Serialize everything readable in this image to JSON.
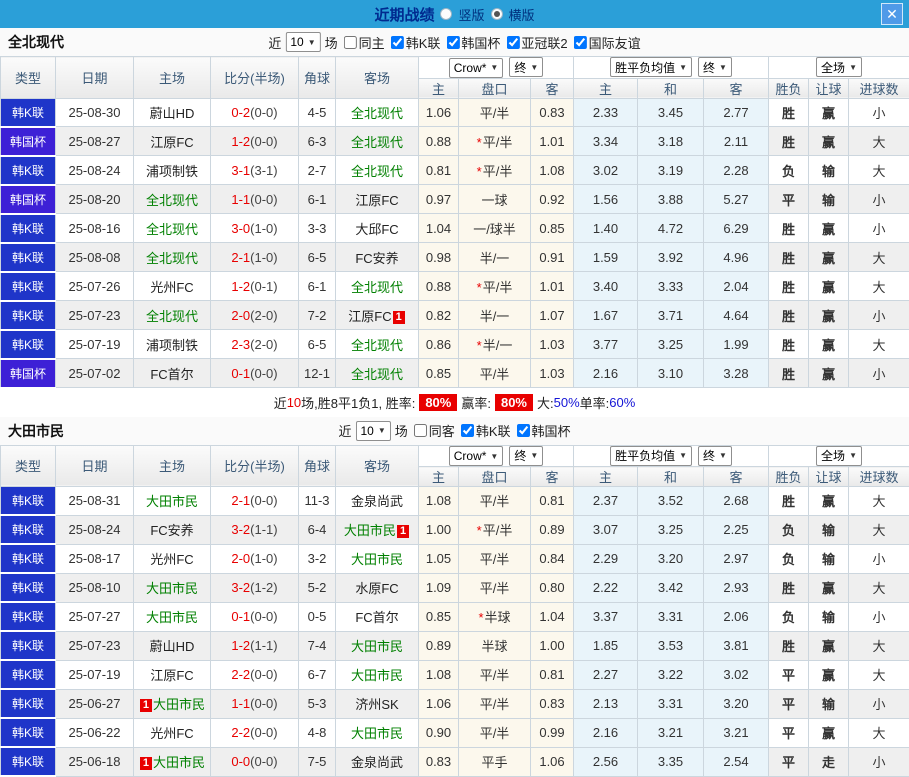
{
  "colors": {
    "titlebar_blue": "#2b9fd8",
    "kleague_badge": "#1f35c9",
    "cup_badge": "#3d20d6",
    "win_red": "#d60000",
    "lose_green": "#008000",
    "draw_blue": "#0000e0",
    "odds_bg": "#fcf8ed",
    "avg_bg": "#e9f4fa",
    "summary_badge_bg": "#e80000"
  },
  "titlebar": {
    "title": "近期战绩",
    "vertical_label": "竖版",
    "horizontal_label": "横版",
    "close": "✕"
  },
  "sections": [
    {
      "team": "全北现代",
      "filter": {
        "prefix": "近",
        "count": "10",
        "suffix": "场",
        "same_label": "同主",
        "same_checked": false,
        "leagues": [
          {
            "label": "韩K联",
            "checked": true
          },
          {
            "label": "韩国杯",
            "checked": true
          },
          {
            "label": "亚冠联2",
            "checked": true
          },
          {
            "label": "国际友谊",
            "checked": true
          }
        ]
      },
      "head": {
        "main": [
          "类型",
          "日期",
          "主场",
          "比分(半场)",
          "角球",
          "客场"
        ],
        "sub": [
          "主",
          "盘口",
          "客",
          "主",
          "和",
          "客",
          "胜负",
          "让球",
          "进球数"
        ],
        "selects": {
          "book": "Crow*",
          "end1": "终",
          "avg": "胜平负均值",
          "end2": "终",
          "scope": "全场"
        }
      },
      "rows": [
        {
          "lg": "韩K联",
          "lgc": "kl",
          "date": "25-08-30",
          "home": {
            "n": "蔚山HD"
          },
          "score": "0-2",
          "half": "(0-0)",
          "cor": "4-5",
          "away": {
            "n": "全北现代",
            "g": 1
          },
          "o1": "1.06",
          "star": "",
          "pk": "平/半",
          "o2": "0.83",
          "m1": "2.33",
          "m2": "3.45",
          "m3": "2.77",
          "res": "胜",
          "ret": "赢",
          "goal": "小"
        },
        {
          "lg": "韩国杯",
          "lgc": "cup",
          "date": "25-08-27",
          "home": {
            "n": "江原FC"
          },
          "score": "1-2",
          "half": "(0-0)",
          "cor": "6-3",
          "away": {
            "n": "全北现代",
            "g": 1
          },
          "o1": "0.88",
          "star": "*",
          "pk": "平/半",
          "o2": "1.01",
          "m1": "3.34",
          "m2": "3.18",
          "m3": "2.11",
          "res": "胜",
          "ret": "赢",
          "goal": "大"
        },
        {
          "lg": "韩K联",
          "lgc": "kl",
          "date": "25-08-24",
          "home": {
            "n": "浦项制铁"
          },
          "score": "3-1",
          "half": "(3-1)",
          "cor": "2-7",
          "away": {
            "n": "全北现代",
            "g": 1
          },
          "o1": "0.81",
          "star": "*",
          "pk": "平/半",
          "o2": "1.08",
          "m1": "3.02",
          "m2": "3.19",
          "m3": "2.28",
          "res": "负",
          "ret": "输",
          "goal": "大"
        },
        {
          "lg": "韩国杯",
          "lgc": "cup",
          "date": "25-08-20",
          "home": {
            "n": "全北现代",
            "g": 1
          },
          "score": "1-1",
          "half": "(0-0)",
          "cor": "6-1",
          "away": {
            "n": "江原FC"
          },
          "o1": "0.97",
          "star": "",
          "pk": "一球",
          "o2": "0.92",
          "m1": "1.56",
          "m2": "3.88",
          "m3": "5.27",
          "res": "平",
          "ret": "输",
          "goal": "小"
        },
        {
          "lg": "韩K联",
          "lgc": "kl",
          "date": "25-08-16",
          "home": {
            "n": "全北现代",
            "g": 1
          },
          "score": "3-0",
          "half": "(1-0)",
          "cor": "3-3",
          "away": {
            "n": "大邱FC"
          },
          "o1": "1.04",
          "star": "",
          "pk": "一/球半",
          "o2": "0.85",
          "m1": "1.40",
          "m2": "4.72",
          "m3": "6.29",
          "res": "胜",
          "ret": "赢",
          "goal": "小"
        },
        {
          "lg": "韩K联",
          "lgc": "kl",
          "date": "25-08-08",
          "home": {
            "n": "全北现代",
            "g": 1
          },
          "score": "2-1",
          "half": "(1-0)",
          "cor": "6-5",
          "away": {
            "n": "FC安养"
          },
          "o1": "0.98",
          "star": "",
          "pk": "半/一",
          "o2": "0.91",
          "m1": "1.59",
          "m2": "3.92",
          "m3": "4.96",
          "res": "胜",
          "ret": "赢",
          "goal": "大"
        },
        {
          "lg": "韩K联",
          "lgc": "kl",
          "date": "25-07-26",
          "home": {
            "n": "光州FC"
          },
          "score": "1-2",
          "half": "(0-1)",
          "cor": "6-1",
          "away": {
            "n": "全北现代",
            "g": 1
          },
          "o1": "0.88",
          "star": "*",
          "pk": "平/半",
          "o2": "1.01",
          "m1": "3.40",
          "m2": "3.33",
          "m3": "2.04",
          "res": "胜",
          "ret": "赢",
          "goal": "大"
        },
        {
          "lg": "韩K联",
          "lgc": "kl",
          "date": "25-07-23",
          "home": {
            "n": "全北现代",
            "g": 1
          },
          "score": "2-0",
          "half": "(2-0)",
          "cor": "7-2",
          "away": {
            "n": "江原FC",
            "b_after": "1"
          },
          "o1": "0.82",
          "star": "",
          "pk": "半/一",
          "o2": "1.07",
          "m1": "1.67",
          "m2": "3.71",
          "m3": "4.64",
          "res": "胜",
          "ret": "赢",
          "goal": "小"
        },
        {
          "lg": "韩K联",
          "lgc": "kl",
          "date": "25-07-19",
          "home": {
            "n": "浦项制铁"
          },
          "score": "2-3",
          "half": "(2-0)",
          "cor": "6-5",
          "away": {
            "n": "全北现代",
            "g": 1
          },
          "o1": "0.86",
          "star": "*",
          "pk": "半/一",
          "o2": "1.03",
          "m1": "3.77",
          "m2": "3.25",
          "m3": "1.99",
          "res": "胜",
          "ret": "赢",
          "goal": "大"
        },
        {
          "lg": "韩国杯",
          "lgc": "cup",
          "date": "25-07-02",
          "home": {
            "n": "FC首尔"
          },
          "score": "0-1",
          "half": "(0-0)",
          "cor": "12-1",
          "away": {
            "n": "全北现代",
            "g": 1
          },
          "o1": "0.85",
          "star": "",
          "pk": "平/半",
          "o2": "1.03",
          "m1": "2.16",
          "m2": "3.10",
          "m3": "3.28",
          "res": "胜",
          "ret": "赢",
          "goal": "小"
        }
      ],
      "summary": [
        {
          "t": "近",
          "c": "k"
        },
        {
          "t": "10",
          "c": "r"
        },
        {
          "t": "场,胜8平1负1, 胜率:",
          "c": "k"
        },
        {
          "t": "80%",
          "c": "badge"
        },
        {
          "t": "赢率:",
          "c": "k"
        },
        {
          "t": "80%",
          "c": "badge"
        },
        {
          "t": "大:",
          "c": "k"
        },
        {
          "t": "50%",
          "c": "b"
        },
        {
          "t": " 单率:",
          "c": "k"
        },
        {
          "t": "60%",
          "c": "b"
        }
      ]
    },
    {
      "team": "大田市民",
      "filter": {
        "prefix": "近",
        "count": "10",
        "suffix": "场",
        "same_label": "同客",
        "same_checked": false,
        "leagues": [
          {
            "label": "韩K联",
            "checked": true
          },
          {
            "label": "韩国杯",
            "checked": true
          }
        ]
      },
      "head": {
        "main": [
          "类型",
          "日期",
          "主场",
          "比分(半场)",
          "角球",
          "客场"
        ],
        "sub": [
          "主",
          "盘口",
          "客",
          "主",
          "和",
          "客",
          "胜负",
          "让球",
          "进球数"
        ],
        "selects": {
          "book": "Crow*",
          "end1": "终",
          "avg": "胜平负均值",
          "end2": "终",
          "scope": "全场"
        }
      },
      "rows": [
        {
          "lg": "韩K联",
          "lgc": "kl",
          "date": "25-08-31",
          "home": {
            "n": "大田市民",
            "g": 1
          },
          "score": "2-1",
          "half": "(0-0)",
          "cor": "11-3",
          "away": {
            "n": "金泉尚武"
          },
          "o1": "1.08",
          "star": "",
          "pk": "平/半",
          "o2": "0.81",
          "m1": "2.37",
          "m2": "3.52",
          "m3": "2.68",
          "res": "胜",
          "ret": "赢",
          "goal": "大"
        },
        {
          "lg": "韩K联",
          "lgc": "kl",
          "date": "25-08-24",
          "home": {
            "n": "FC安养"
          },
          "score": "3-2",
          "half": "(1-1)",
          "cor": "6-4",
          "away": {
            "n": "大田市民",
            "g": 1,
            "b_after": "1"
          },
          "o1": "1.00",
          "star": "*",
          "pk": "平/半",
          "o2": "0.89",
          "m1": "3.07",
          "m2": "3.25",
          "m3": "2.25",
          "res": "负",
          "ret": "输",
          "goal": "大"
        },
        {
          "lg": "韩K联",
          "lgc": "kl",
          "date": "25-08-17",
          "home": {
            "n": "光州FC"
          },
          "score": "2-0",
          "half": "(1-0)",
          "cor": "3-2",
          "away": {
            "n": "大田市民",
            "g": 1
          },
          "o1": "1.05",
          "star": "",
          "pk": "平/半",
          "o2": "0.84",
          "m1": "2.29",
          "m2": "3.20",
          "m3": "2.97",
          "res": "负",
          "ret": "输",
          "goal": "小"
        },
        {
          "lg": "韩K联",
          "lgc": "kl",
          "date": "25-08-10",
          "home": {
            "n": "大田市民",
            "g": 1
          },
          "score": "3-2",
          "half": "(1-2)",
          "cor": "5-2",
          "away": {
            "n": "水原FC"
          },
          "o1": "1.09",
          "star": "",
          "pk": "平/半",
          "o2": "0.80",
          "m1": "2.22",
          "m2": "3.42",
          "m3": "2.93",
          "res": "胜",
          "ret": "赢",
          "goal": "大"
        },
        {
          "lg": "韩K联",
          "lgc": "kl",
          "date": "25-07-27",
          "home": {
            "n": "大田市民",
            "g": 1
          },
          "score": "0-1",
          "half": "(0-0)",
          "cor": "0-5",
          "away": {
            "n": "FC首尔"
          },
          "o1": "0.85",
          "star": "*",
          "pk": "半球",
          "o2": "1.04",
          "m1": "3.37",
          "m2": "3.31",
          "m3": "2.06",
          "res": "负",
          "ret": "输",
          "goal": "小"
        },
        {
          "lg": "韩K联",
          "lgc": "kl",
          "date": "25-07-23",
          "home": {
            "n": "蔚山HD"
          },
          "score": "1-2",
          "half": "(1-1)",
          "cor": "7-4",
          "away": {
            "n": "大田市民",
            "g": 1
          },
          "o1": "0.89",
          "star": "",
          "pk": "半球",
          "o2": "1.00",
          "m1": "1.85",
          "m2": "3.53",
          "m3": "3.81",
          "res": "胜",
          "ret": "赢",
          "goal": "大"
        },
        {
          "lg": "韩K联",
          "lgc": "kl",
          "date": "25-07-19",
          "home": {
            "n": "江原FC"
          },
          "score": "2-2",
          "half": "(0-0)",
          "cor": "6-7",
          "away": {
            "n": "大田市民",
            "g": 1
          },
          "o1": "1.08",
          "star": "",
          "pk": "平/半",
          "o2": "0.81",
          "m1": "2.27",
          "m2": "3.22",
          "m3": "3.02",
          "res": "平",
          "ret": "赢",
          "goal": "大"
        },
        {
          "lg": "韩K联",
          "lgc": "kl",
          "date": "25-06-27",
          "home": {
            "n": "大田市民",
            "g": 1,
            "b_before": "1"
          },
          "score": "1-1",
          "half": "(0-0)",
          "cor": "5-3",
          "away": {
            "n": "济州SK"
          },
          "o1": "1.06",
          "star": "",
          "pk": "平/半",
          "o2": "0.83",
          "m1": "2.13",
          "m2": "3.31",
          "m3": "3.20",
          "res": "平",
          "ret": "输",
          "goal": "小"
        },
        {
          "lg": "韩K联",
          "lgc": "kl",
          "date": "25-06-22",
          "home": {
            "n": "光州FC"
          },
          "score": "2-2",
          "half": "(0-0)",
          "cor": "4-8",
          "away": {
            "n": "大田市民",
            "g": 1
          },
          "o1": "0.90",
          "star": "",
          "pk": "平/半",
          "o2": "0.99",
          "m1": "2.16",
          "m2": "3.21",
          "m3": "3.21",
          "res": "平",
          "ret": "赢",
          "goal": "大"
        },
        {
          "lg": "韩K联",
          "lgc": "kl",
          "date": "25-06-18",
          "home": {
            "n": "大田市民",
            "g": 1,
            "b_before": "1"
          },
          "score": "0-0",
          "half": "(0-0)",
          "cor": "7-5",
          "away": {
            "n": "金泉尚武"
          },
          "o1": "0.83",
          "star": "",
          "pk": "平手",
          "o2": "1.06",
          "m1": "2.56",
          "m2": "3.35",
          "m3": "2.54",
          "res": "平",
          "ret": "走",
          "goal": "小"
        }
      ],
      "summary": null
    }
  ]
}
